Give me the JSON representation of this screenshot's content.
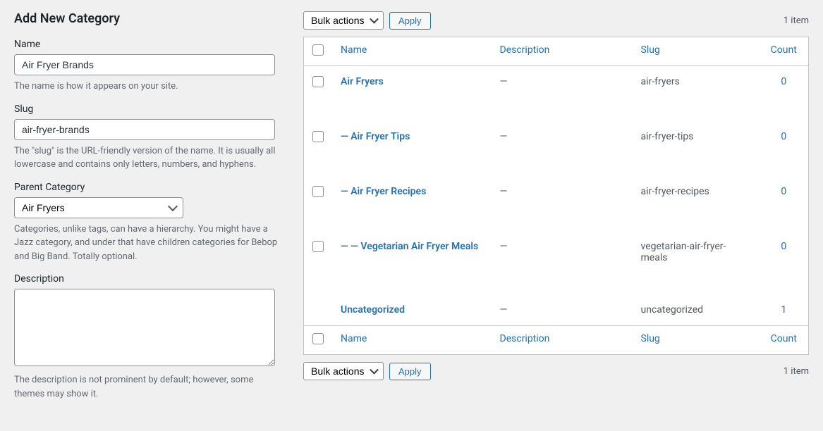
{
  "form": {
    "title": "Add New Category",
    "name_label": "Name",
    "name_value": "Air Fryer Brands",
    "name_help": "The name is how it appears on your site.",
    "slug_label": "Slug",
    "slug_value": "air-fryer-brands",
    "slug_help": "The \"slug\" is the URL-friendly version of the name. It is usually all lowercase and contains only letters, numbers, and hyphens.",
    "parent_label": "Parent Category",
    "parent_value": "Air Fryers",
    "parent_help": "Categories, unlike tags, can have a hierarchy. You might have a Jazz category, and under that have children categories for Bebop and Big Band. Totally optional.",
    "desc_label": "Description",
    "desc_value": "",
    "desc_help": "The description is not prominent by default; however, some themes may show it."
  },
  "list": {
    "bulk_label": "Bulk actions",
    "apply_label": "Apply",
    "item_count_top": "1 item",
    "item_count_bottom": "1 item",
    "headers": {
      "name": "Name",
      "desc": "Description",
      "slug": "Slug",
      "count": "Count"
    },
    "rows": [
      {
        "name": "Air Fryers",
        "desc": "—",
        "slug": "air-fryers",
        "count": "0"
      },
      {
        "name": "— Air Fryer Tips",
        "desc": "—",
        "slug": "air-fryer-tips",
        "count": "0"
      },
      {
        "name": "— Air Fryer Recipes",
        "desc": "—",
        "slug": "air-fryer-recipes",
        "count": "0"
      },
      {
        "name": "— — Vegetarian Air Fryer Meals",
        "desc": "—",
        "slug": "vegetarian-air-fryer-meals",
        "count": "0"
      },
      {
        "name": "Uncategorized",
        "desc": "—",
        "slug": "uncategorized",
        "count": "1"
      }
    ]
  }
}
